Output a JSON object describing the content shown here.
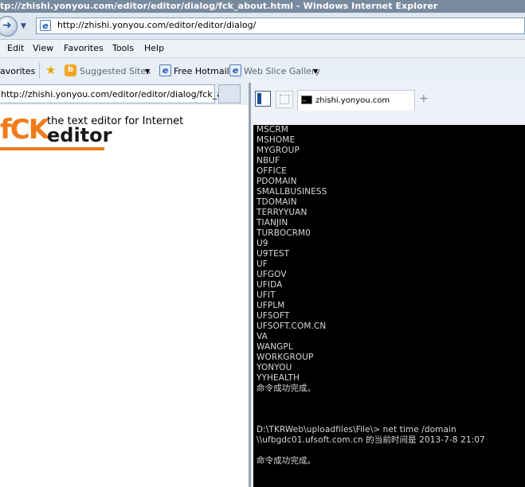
{
  "window": {
    "title": "tp://zhishi.yonyou.com/editor/editor/dialog/fck_about.html - Windows Internet Explorer"
  },
  "address_bar": {
    "url": "http://zhishi.yonyou.com/editor/editor/dialog/"
  },
  "menu": {
    "items": [
      "Edit",
      "View",
      "Favorites",
      "Tools",
      "Help"
    ]
  },
  "favorites_bar": {
    "favorites_label": "avorites",
    "suggested_sites": "Suggested Sites",
    "free_hotmail": "Free Hotmail",
    "web_slice_gallery": "Web Slice Gallery"
  },
  "left_tab": {
    "title": "http://zhishi.yonyou.com/editor/editor/dialog/fck_abo..."
  },
  "left_page": {
    "logo_fck": "fCK",
    "tagline": "the text editor for Internet",
    "logo_editor": "editor"
  },
  "right_window": {
    "tab_label": "zhishi.yonyou.com",
    "new_tab_symbol": "+"
  },
  "console": {
    "lines": [
      "MSCRM",
      "MSHOME",
      "MYGROUP",
      "NBUF",
      "OFFICE",
      "PDOMAIN",
      "SMALLBUSINESS",
      "TDOMAIN",
      "TERRYYUAN",
      "TIANJIN",
      "TURBOCRM0",
      "U9",
      "U9TEST",
      "UF",
      "UFGOV",
      "UFIDA",
      "UFIT",
      "UFPLM",
      "UFSOFT",
      "UFSOFT.COM.CN",
      "VA",
      "WANGPL",
      "WORKGROUP",
      "YONYOU",
      "YYHEALTH",
      "命令成功完成。",
      "",
      "",
      "",
      "D:\\TKRWeb\\uploadfiles\\File\\> net time /domain",
      "\\\\ufbgdc01.ufsoft.com.cn 的当前时间是 2013-7-8 21:07",
      "",
      "命令成功完成。"
    ]
  },
  "colors": {
    "fck_orange": "#f07b1b",
    "console_bg": "#000000",
    "console_fg": "#d8d8d8"
  }
}
